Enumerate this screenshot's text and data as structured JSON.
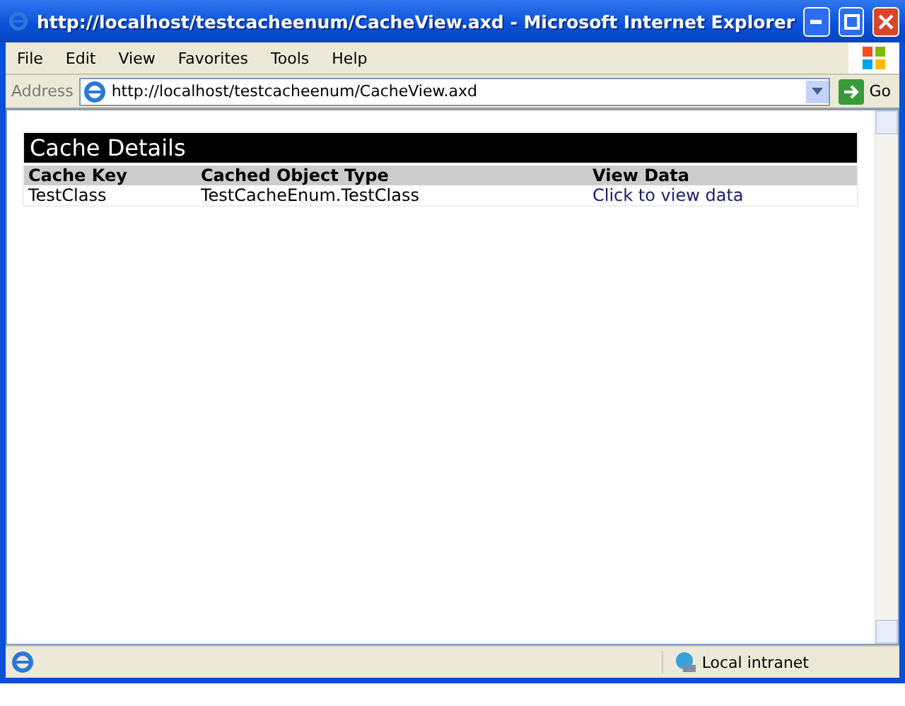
{
  "window": {
    "title": "http://localhost/testcacheenum/CacheView.axd - Microsoft Internet Explorer"
  },
  "menu": [
    "File",
    "Edit",
    "View",
    "Favorites",
    "Tools",
    "Help"
  ],
  "address_bar": {
    "label": "Address",
    "value": "http://localhost/testcacheenum/CacheView.axd",
    "go": "Go"
  },
  "page": {
    "heading": "Cache Details",
    "columns": [
      "Cache Key",
      "Cached Object Type",
      "View Data"
    ],
    "rows": [
      {
        "cells": [
          "TestClass",
          "TestCacheEnum.TestClass"
        ],
        "link": "Click to view data"
      }
    ]
  },
  "status_bar": {
    "zone": "Local intranet"
  }
}
